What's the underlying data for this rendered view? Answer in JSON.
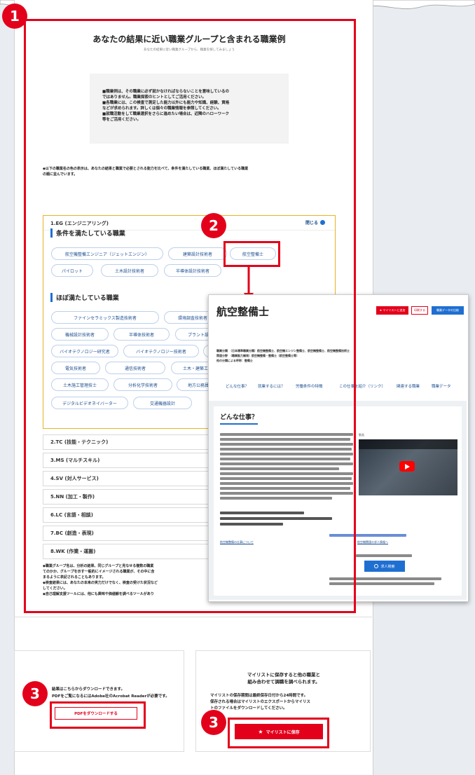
{
  "main": {
    "title": "あなたの結果に近い職業グループと含まれる職業例",
    "subtitle": "あなたの結果に近い職業グループから、職業を探してみましょう",
    "notice_line1": "■職業例は、その職業に必ず就かなければならないことを意味しているの",
    "notice_line2": "ではありません。職業探索のヒントとしてご活用ください。",
    "notice_line3": "■各職業には、この検査で測定した能力以外にも能力や知識、経験、資格",
    "notice_line4": "などが求められます。詳しくは個々の職業情報を参照してください。",
    "notice_line5": "■就職活動をして職業選択をさらに進めたい場合は、近隣のハローワーク",
    "notice_line6": "等をご活用ください。",
    "lead_line1": "◆以下の職業名の色の表示は、あなたの結果と職業で必要とされる能力を比べて、条件を満たしている職業、ほぼ満たしている職業",
    "lead_line2": "の順に並んでいます。"
  },
  "accordion": {
    "open_title": "1.EG (エンジニアリング)",
    "close_label": "閉じる",
    "section1_title": "条件を満たしている職業",
    "section2_title": "ほぼ満たしている職業",
    "satisfied": [
      "航空機整備エンジニア（ジェットエンジン）",
      "建築設計技術者",
      "航空整備士",
      "パイロット",
      "土木設計技術者",
      "半導体設計技術者"
    ],
    "mostly": [
      "ファインセラミックス製造技術者",
      "環境調査技術者",
      "",
      "機械設計技術者",
      "半導体技術者",
      "プラント設計技術者",
      "バイオテクノロジー研究者",
      "バイオテクノロジー技術者",
      "",
      "電気技術者",
      "通信技術者",
      "土木・建築工",
      "土木施工管理技士",
      "分析化学技術者",
      "地方公務員",
      "",
      "デジタルビデオネイバーター",
      "交通機器設計"
    ],
    "other_groups": [
      "2.TC (技能・テクニック)",
      "3.MS (マルチスキル)",
      "4.SV (対人サービス)",
      "5.NN (加工・製作)",
      "6.LC (言語・相談)",
      "7.BC (創造・表現)",
      "8.WK (作業・運搬)"
    ]
  },
  "footnotes": [
    "◆職業グループ名は、分析の結果、同じグループと見なせる複数の職業",
    "てのかか、グループを示す一般的にイメージされる職業が、その中に含",
    "まるように表記されることもあります。",
    "◆検査結果には、あなたの本来の実力だけでなく、検査の受けた状況など",
    "してください。",
    "◆自己理解支援ツールには、他にも興味や価値観を調べるツールがあり"
  ],
  "popup": {
    "title": "航空整備士",
    "add_mylist": "★ マイリストに追加",
    "print_label": "印刷する",
    "compare_label": "職業データの比較",
    "meta_line1": "職業分類　（日本標準職業分類）航空機整備士、航空機エンジン整備士、航空機整備士、航空機整備技術士",
    "meta_line2": "関連分野　（職業能力開発）航空機整備・整備士（航空整備士等）",
    "meta_line3": "他の分類による呼称：整備士",
    "tabs": [
      "どんな仕事？",
      "就業するには？",
      "労働条件の特徴",
      "この仕事を紹介（リンク）",
      "関連する職業",
      "職業データ"
    ],
    "section_title": "どんな仕事？",
    "video_label": "動画",
    "search_label": "求人検索",
    "link1": "航空機整備の仕事について",
    "link2": "航空機関連の求人情報へ"
  },
  "cards": {
    "left_line1": "結果はこちらからダウンロードできます。",
    "left_line2": "PDFをご覧になるにはAdobe社のAcrobat Readerが必要です。",
    "pdf_button": "PDFをダウンロードする",
    "right_line1": "マイリストに保存すると他の職業と",
    "right_line2": "組み合わせて調職を調べられます。",
    "right_line3": "マイリストの保存期間は最終保存日付から24時間です。",
    "right_line4": "保存される場合はマイリストのエクスポートからマイリス",
    "right_line5": "トのファイルをダウンロードしてください。",
    "mylist_button": "マイリストに保存"
  },
  "annotations": [
    "1",
    "2",
    "3",
    "3"
  ],
  "colors": {
    "accent_red": "#e3001b",
    "link_blue": "#1d4f91",
    "button_blue": "#1f6fd1",
    "accordion_border": "#e6b422"
  }
}
